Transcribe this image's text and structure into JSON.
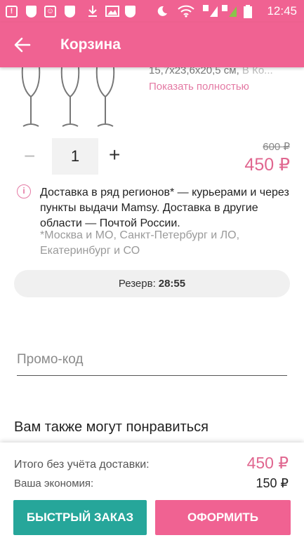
{
  "status_bar": {
    "time": "12:45",
    "icons": [
      "alert-icon",
      "shield-icon",
      "message-icon",
      "shield-icon",
      "download-icon",
      "image-icon",
      "shield-icon",
      "moon-icon",
      "wifi-icon",
      "sim-1-signal-icon",
      "sim-2-signal-icon",
      "battery-icon"
    ]
  },
  "app_bar": {
    "title": "Корзина",
    "back_icon": "arrow-left-icon"
  },
  "product": {
    "description_dark": "15,7x23,6x20,5 см, ",
    "description_light": "В Ко...",
    "show_more": "Показать полностью",
    "quantity": "1",
    "minus_label": "−",
    "plus_label": "+",
    "old_price": "600 ₽",
    "price": "450 ₽"
  },
  "delivery": {
    "text": "Доставка в ряд регионов* — курьерами и через пункты выдачи Mamsy. Доставка в другие области — Почтой России.",
    "note": "*Москва и МО, Санкт-Петербург и ЛО, Екатеринбург и СО"
  },
  "reserve": {
    "label": "Резерв:",
    "time": "28:55"
  },
  "promo": {
    "placeholder": "Промо-код"
  },
  "recommendations": {
    "title": "Вам также могут понравиться"
  },
  "summary": {
    "total_label": "Итого без учёта доставки:",
    "total_value": "450 ₽",
    "savings_label": "Ваша экономия:",
    "savings_value": "150 ₽"
  },
  "buttons": {
    "quick_order": "БЫСТРЫЙ ЗАКАЗ",
    "checkout": "ОФОРМИТЬ"
  },
  "colors": {
    "accent": "#f06292",
    "price": "#e0668f",
    "quick_order": "#26a69a"
  }
}
